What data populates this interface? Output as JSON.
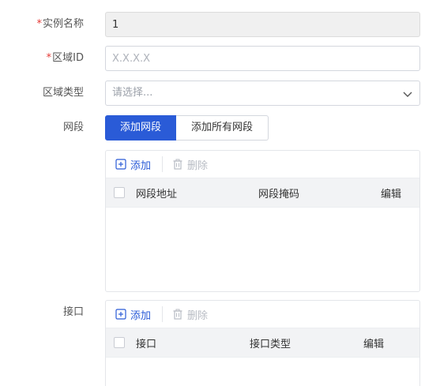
{
  "form": {
    "instance_name": {
      "required_mark": "*",
      "label": "实例名称",
      "value": "1"
    },
    "region_id": {
      "required_mark": "*",
      "label": "区域ID",
      "placeholder": "X.X.X.X"
    },
    "region_type": {
      "label": "区域类型",
      "placeholder": "请选择..."
    },
    "segment": {
      "label": "网段",
      "add_segment_btn": "添加网段",
      "add_all_segments_btn": "添加所有网段",
      "toolbar": {
        "add": "添加",
        "delete": "删除"
      },
      "columns": [
        "网段地址",
        "网段掩码",
        "编辑"
      ]
    },
    "interface": {
      "label": "接口",
      "toolbar": {
        "add": "添加",
        "delete": "删除"
      },
      "columns": [
        "接口",
        "接口类型",
        "编辑"
      ]
    }
  },
  "colors": {
    "primary": "#2a5bd7",
    "required": "#e53935",
    "header_bg": "#f2f3f5",
    "disabled_bg": "#f0f0f0"
  }
}
